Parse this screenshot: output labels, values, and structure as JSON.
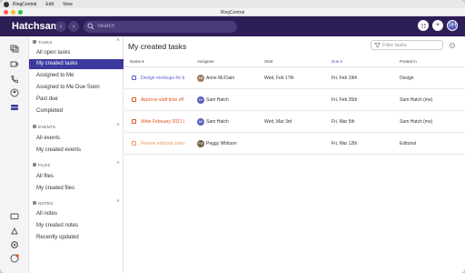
{
  "macbar": {
    "menus": [
      "RingCentral",
      "Edit",
      "View"
    ]
  },
  "window_title": "RingCentral",
  "header": {
    "brand": "Hatchsam",
    "search_placeholder": "Search",
    "user_initials": "SH"
  },
  "sidebar": {
    "tasks": {
      "heading": "TASKS",
      "items": [
        "All open tasks",
        "My created tasks",
        "Assigned to Me",
        "Assigned to Me Due Soon",
        "Past due",
        "Completed"
      ],
      "active_index": 1
    },
    "events": {
      "heading": "EVENTS",
      "items": [
        "All events",
        "My created events"
      ]
    },
    "files": {
      "heading": "FILES",
      "items": [
        "All files",
        "My created files"
      ]
    },
    "notes": {
      "heading": "NOTES",
      "items": [
        "All notes",
        "My created notes",
        "Recently updated"
      ]
    }
  },
  "main": {
    "title": "My created tasks",
    "filter_placeholder": "Filter tasks",
    "columns": {
      "name": "Name",
      "assignee": "Assignee",
      "start": "Start",
      "due": "Due",
      "posted": "Posted in"
    },
    "tasks": [
      {
        "name": "Design mockups for b",
        "color": "#5b5bd6",
        "assignee": "Anne McClain",
        "avatar_initials": "AM",
        "avatar_color": "#9a7b5b",
        "start": "Wed, Feb 17th",
        "due": "Fri, Feb 19th",
        "posted": "Design"
      },
      {
        "name": "Approve staff time off",
        "color": "#e0531f",
        "assignee": "Sam Hatch",
        "avatar_initials": "SH",
        "avatar_color": "#5a5fb8",
        "start": "",
        "due": "Fri, Feb 26th",
        "posted": "Sam Hatch (me)"
      },
      {
        "name": "Write February 2021 l",
        "color": "#e0531f",
        "assignee": "Sam Hatch",
        "avatar_initials": "SH",
        "avatar_color": "#5a5fb8",
        "start": "Wed, Mar 3rd",
        "due": "Fri, Mar 5th",
        "posted": "Sam Hatch (me)"
      },
      {
        "name": "Review editorial calen",
        "color": "#f09a5a",
        "assignee": "Peggy Whitson",
        "avatar_initials": "PW",
        "avatar_color": "#6d5d4b",
        "start": "",
        "due": "Fri, Mar 12th",
        "posted": "Editorial"
      }
    ]
  },
  "colors": {
    "header_bg": "#2e1e57",
    "active_item": "#3c3a9e",
    "due_header": "#3b5bdb"
  }
}
